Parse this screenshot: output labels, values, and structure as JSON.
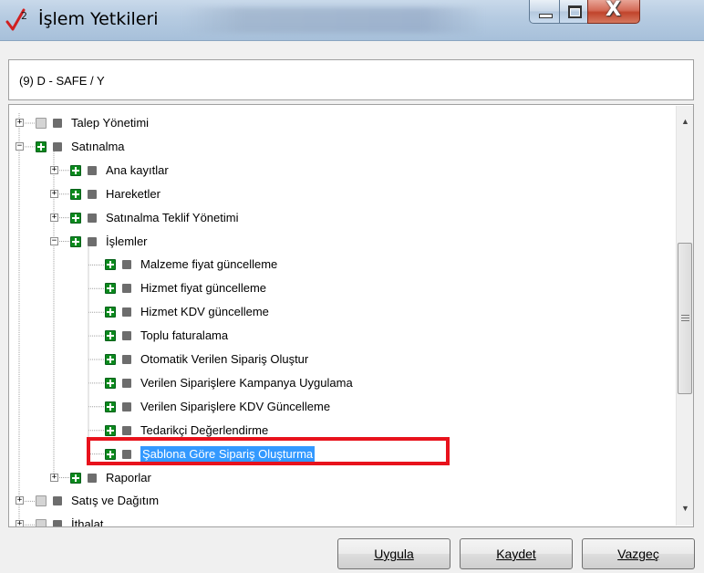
{
  "window": {
    "title": "İşlem Yetkileri",
    "close_glyph": "X"
  },
  "context": {
    "label": "(9) D - SAFE / Y"
  },
  "tree": {
    "rows": [
      {
        "label": "Talep Yönetimi",
        "level": 0,
        "expander": "+",
        "state": "gray"
      },
      {
        "label": "Satınalma",
        "level": 0,
        "expander": "-",
        "state": "green"
      },
      {
        "label": "Ana kayıtlar",
        "level": 1,
        "expander": "+",
        "state": "green"
      },
      {
        "label": "Hareketler",
        "level": 1,
        "expander": "+",
        "state": "green"
      },
      {
        "label": "Satınalma Teklif Yönetimi",
        "level": 1,
        "expander": "+",
        "state": "green"
      },
      {
        "label": "İşlemler",
        "level": 1,
        "expander": "-",
        "state": "green"
      },
      {
        "label": "Malzeme fiyat güncelleme",
        "level": 2,
        "expander": "",
        "state": "green"
      },
      {
        "label": "Hizmet fiyat güncelleme",
        "level": 2,
        "expander": "",
        "state": "green"
      },
      {
        "label": "Hizmet KDV güncelleme",
        "level": 2,
        "expander": "",
        "state": "green"
      },
      {
        "label": "Toplu faturalama",
        "level": 2,
        "expander": "",
        "state": "green"
      },
      {
        "label": "Otomatik Verilen Sipariş Oluştur",
        "level": 2,
        "expander": "",
        "state": "green"
      },
      {
        "label": "Verilen Siparişlere Kampanya Uygulama",
        "level": 2,
        "expander": "",
        "state": "green"
      },
      {
        "label": "Verilen Siparişlere KDV Güncelleme",
        "level": 2,
        "expander": "",
        "state": "green"
      },
      {
        "label": "Tedarikçi Değerlendirme",
        "level": 2,
        "expander": "",
        "state": "green"
      },
      {
        "label": "Şablona Göre Sipariş Oluşturma",
        "level": 2,
        "expander": "",
        "state": "green",
        "selected": true
      },
      {
        "label": "Raporlar",
        "level": 1,
        "expander": "+",
        "state": "green"
      },
      {
        "label": "Satış ve Dağıtım",
        "level": 0,
        "expander": "+",
        "state": "gray"
      },
      {
        "label": "İthalat",
        "level": 0,
        "expander": "+",
        "state": "gray"
      }
    ]
  },
  "scrollbar": {
    "up_icon": "▲",
    "down_icon": "▼"
  },
  "buttons": {
    "apply": "Uygula",
    "save": "Kaydet",
    "cancel": "Vazgeç"
  },
  "colors": {
    "checked_green": "#0b8a1d",
    "selection_blue": "#3399ff",
    "highlight_red": "#e8121c"
  }
}
